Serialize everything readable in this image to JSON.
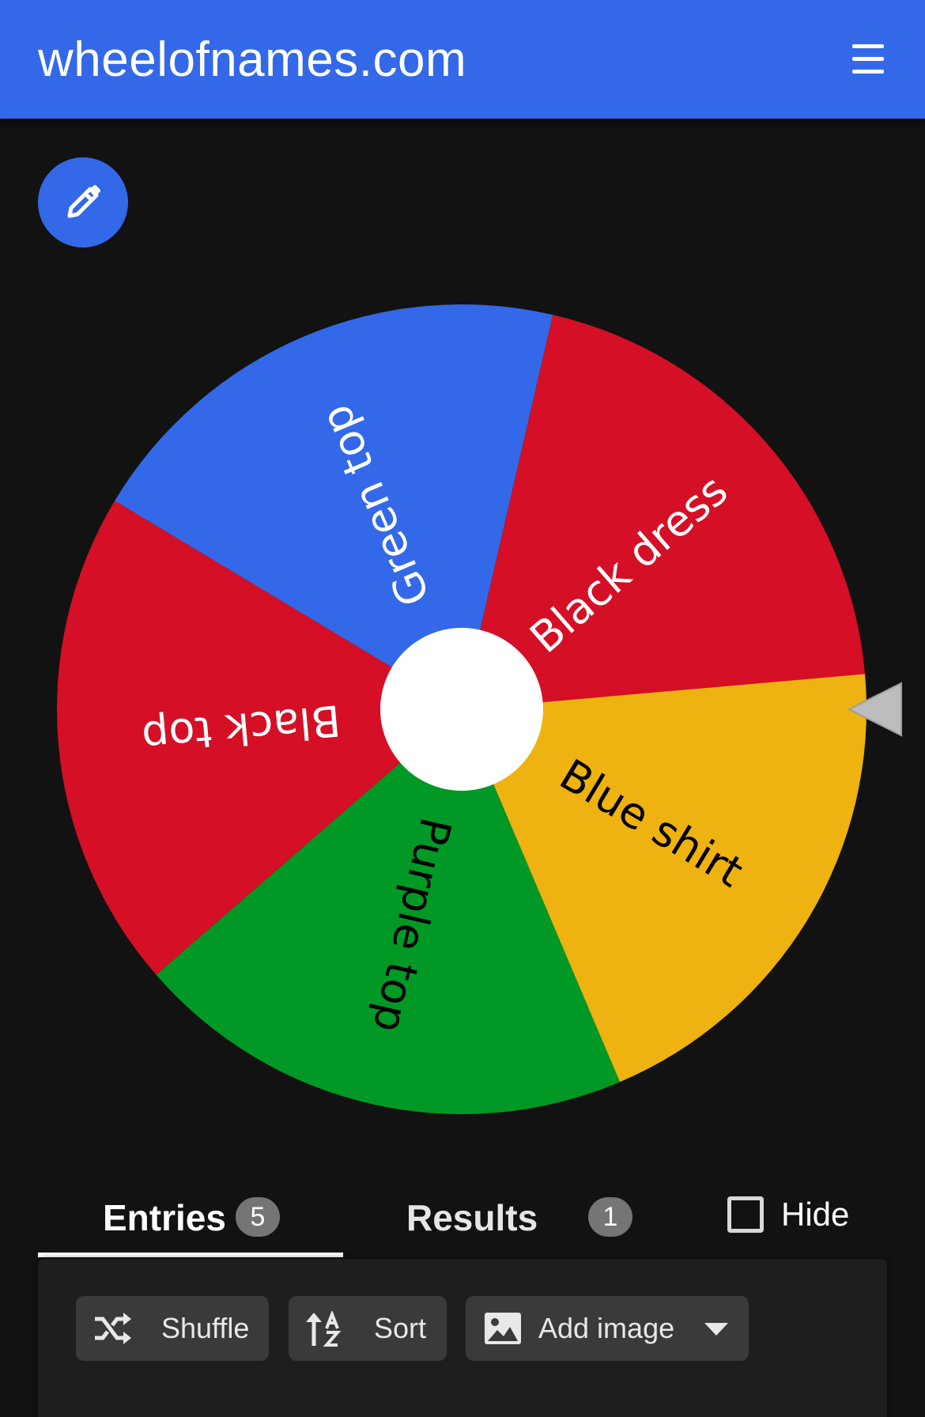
{
  "header": {
    "title": "wheelofnames.com",
    "menu_icon": "hamburger-menu-icon"
  },
  "edit_button": {
    "icon": "pencil-icon"
  },
  "wheel": {
    "segments": [
      {
        "label": "Black dress",
        "color": "#d50f25",
        "text_color": "#ffffff"
      },
      {
        "label": "Green top",
        "color": "#3369e8",
        "text_color": "#ffffff"
      },
      {
        "label": "Black top",
        "color": "#d50f25",
        "text_color": "#ffffff"
      },
      {
        "label": "Purple top",
        "color": "#009925",
        "text_color": "#000000"
      },
      {
        "label": "Blue shirt",
        "color": "#eeb211",
        "text_color": "#000000"
      }
    ],
    "center_color": "#ffffff",
    "pointer_color": "#bdbdbd"
  },
  "tabs": [
    {
      "label": "Entries",
      "count": "5",
      "active": true
    },
    {
      "label": "Results",
      "count": "1",
      "active": false
    }
  ],
  "hide_toggle": {
    "label": "Hide",
    "checked": false
  },
  "toolbar": {
    "shuffle_label": "Shuffle",
    "sort_label": "Sort",
    "add_image_label": "Add image"
  },
  "colors": {
    "accent": "#3369e8",
    "background": "#121212",
    "panel": "#1e1e1e"
  }
}
